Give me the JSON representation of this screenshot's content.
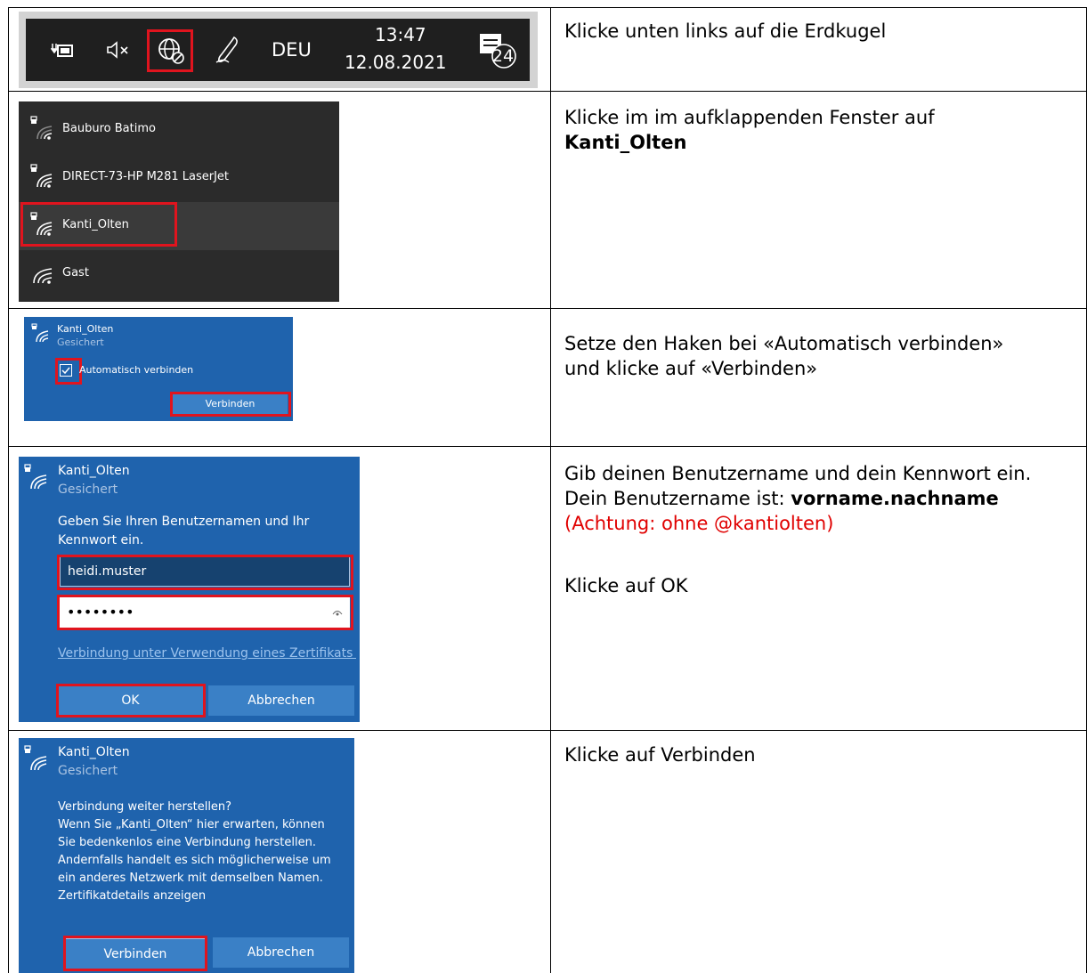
{
  "rows": [
    {
      "screenshot": {
        "tray_icons": [
          "battery-plug-icon",
          "speaker-muted-icon",
          "globe-no-connection-icon",
          "pen-icon",
          "notification-icon"
        ],
        "language": "DEU",
        "time": "13:47",
        "date": "12.08.2021",
        "notification_count": "24"
      },
      "instruction": "Klicke unten links auf die Erdkugel"
    },
    {
      "screenshot": {
        "networks": [
          {
            "name": "Bauburo Batimo",
            "secured": true
          },
          {
            "name": "DIRECT-73-HP M281 LaserJet",
            "secured": true
          },
          {
            "name": "Kanti_Olten",
            "secured": true,
            "selected": true
          },
          {
            "name": "Gast",
            "secured": false
          }
        ]
      },
      "instruction_text": "Klicke im im aufklappenden Fenster auf",
      "instruction_bold": "Kanti_Olten"
    },
    {
      "screenshot": {
        "network": "Kanti_Olten",
        "status": "Gesichert",
        "checkbox_label": "Automatisch verbinden",
        "checkbox_checked": true,
        "connect_button": "Verbinden"
      },
      "instruction_line1": "Setze den Haken bei «Automatisch verbinden»",
      "instruction_line2": "und klicke auf «Verbinden»"
    },
    {
      "screenshot": {
        "network": "Kanti_Olten",
        "status": "Gesichert",
        "prompt": "Geben Sie Ihren Benutzernamen und Ihr Kennwort ein.",
        "username": "heidi.muster",
        "password_mask": "••••••••",
        "cert_link": "Verbindung unter Verwendung eines Zertifikats h",
        "ok_button": "OK",
        "cancel_button": "Abbrechen"
      },
      "instruction_line1": "Gib deinen Benutzername und dein Kennwort ein.",
      "instruction_line2_prefix": "Dein Benutzername ist: ",
      "instruction_line2_bold": "vorname.nachname",
      "instruction_warning": "(Achtung: ohne @kantiolten)",
      "instruction_line3": "Klicke auf OK"
    },
    {
      "screenshot": {
        "network": "Kanti_Olten",
        "status": "Gesichert",
        "message_lines": [
          "Verbindung weiter herstellen?",
          "Wenn Sie „Kanti_Olten“ hier erwarten, können",
          "Sie bedenkenlos eine Verbindung herstellen.",
          "Andernfalls handelt es sich möglicherweise um",
          "ein anderes Netzwerk mit demselben Namen.",
          "Zertifikatdetails anzeigen"
        ],
        "connect_button": "Verbinden",
        "cancel_button": "Abbrechen"
      },
      "instruction": "Klicke auf Verbinden"
    }
  ],
  "colors": {
    "highlight": "#e0141e",
    "dialog_blue": "#1f63ad",
    "taskbar": "#1f1f1f",
    "wifi_panel": "#2b2b2b",
    "warning_text": "#e00000"
  }
}
